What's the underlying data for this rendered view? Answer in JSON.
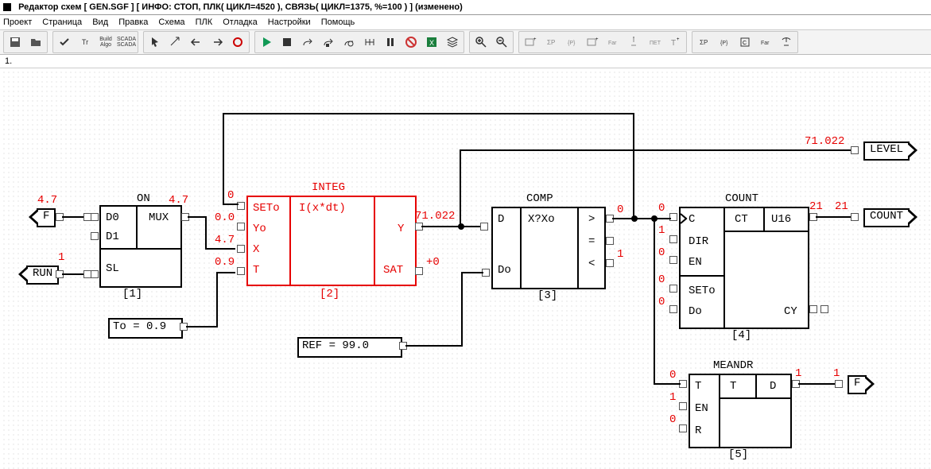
{
  "window": {
    "title": "Редактор схем [ GEN.SGF ] [ ИНФО:  СТОП, ПЛК( ЦИКЛ=4520 ), СВЯЗЬ( ЦИКЛ=1375, %=100 ) ] (изменено)"
  },
  "menu": [
    "Проект",
    "Страница",
    "Вид",
    "Правка",
    "Схема",
    "ПЛК",
    "Отладка",
    "Настройки",
    "Помощь"
  ],
  "tab": "1.",
  "blocks": {
    "b1": {
      "title": "ON",
      "id": "[1]",
      "ports": {
        "d0": "D0",
        "d1": "D1",
        "sl": "SL",
        "mux": "MUX"
      }
    },
    "b2": {
      "title": "INTEG",
      "id": "[2]",
      "func": "I(x*dt)",
      "ports": {
        "seto": "SETo",
        "yo": "Yo",
        "x": "X",
        "t": "T",
        "y": "Y",
        "sat": "SAT"
      }
    },
    "b3": {
      "title": "COMP",
      "id": "[3]",
      "func": "X?Xo",
      "ports": {
        "d": "D",
        "do": "Do",
        "gt": ">",
        "eq": "=",
        "lt": "<"
      }
    },
    "b4": {
      "title": "COUNT",
      "id": "[4]",
      "func": "CT",
      "type": "U16",
      "ports": {
        "c": "C",
        "dir": "DIR",
        "en": "EN",
        "seto": "SETo",
        "do": "Do",
        "cy": "CY"
      }
    },
    "b5": {
      "title": "MEANDR",
      "id": "[5]",
      "func": "T",
      "ports": {
        "t": "T",
        "en": "EN",
        "r": "R",
        "d": "D"
      }
    }
  },
  "constbox": {
    "to": "To = 0.9",
    "ref": "REF = 99.0"
  },
  "ext": {
    "f": "F",
    "run": "RUN",
    "level": "LEVEL",
    "count": "COUNT",
    "fout": "F"
  },
  "values": {
    "f_in": "4.7",
    "run_in": "1",
    "mux_out": "4.7",
    "integ_seto_in": "0",
    "integ_yo_in": "0.0",
    "integ_x_in": "4.7",
    "integ_t_in": "0.9",
    "integ_y_out": "71.022",
    "integ_sat_out": "+0",
    "comp_gt_out": "0",
    "comp_eq_out": "-",
    "comp_lt_out": "1",
    "count_c_in": "0",
    "count_dir_in": "1",
    "count_en_in": "0",
    "count_seto_in": "0",
    "count_do_in": "0",
    "count_out": "21",
    "count_wire": "21",
    "meandr_t_in": "0",
    "meandr_en_in": "1",
    "meandr_r_in": "0",
    "meandr_d_out": "1",
    "meandr_wire": "1",
    "level_val": "71.022"
  }
}
